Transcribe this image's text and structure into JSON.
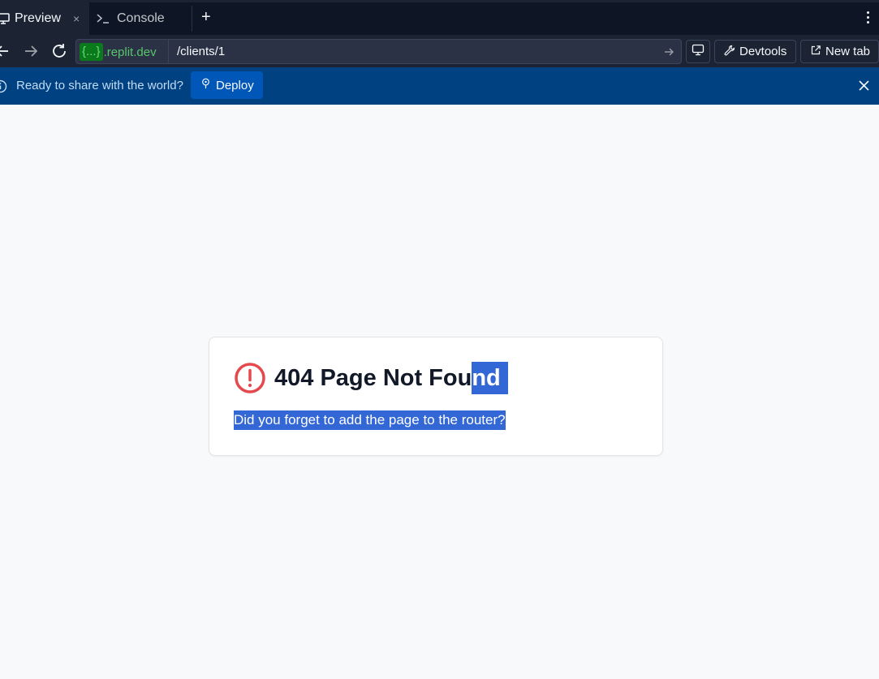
{
  "tabs": [
    {
      "label": "Preview",
      "icon": "monitor-icon",
      "active": true
    },
    {
      "label": "Console",
      "icon": "terminal-icon",
      "active": false
    }
  ],
  "tab_close": "×",
  "tab_add": "+",
  "url": {
    "domain_braces": "{...}",
    "domain_host": ".replit.dev",
    "path": "/clients/1"
  },
  "toolbar": {
    "devtools_label": "Devtools",
    "newtab_label": "New tab"
  },
  "banner": {
    "text": "Ready to share with the world?",
    "deploy_label": "Deploy"
  },
  "error_card": {
    "title_unselected": "404 Page Not Fou",
    "title_selected": "nd",
    "description": "Did you forget to add the page to the router?"
  },
  "colors": {
    "tab_bar_bg": "#0e1525",
    "url_bar_bg": "#1c2333",
    "banner_bg": "#004182",
    "deploy_button_bg": "#0057b8",
    "domain_green": "#58c56c",
    "error_red": "#e5484d",
    "selection_blue": "#3367d6",
    "page_bg": "#f8f9fb"
  }
}
